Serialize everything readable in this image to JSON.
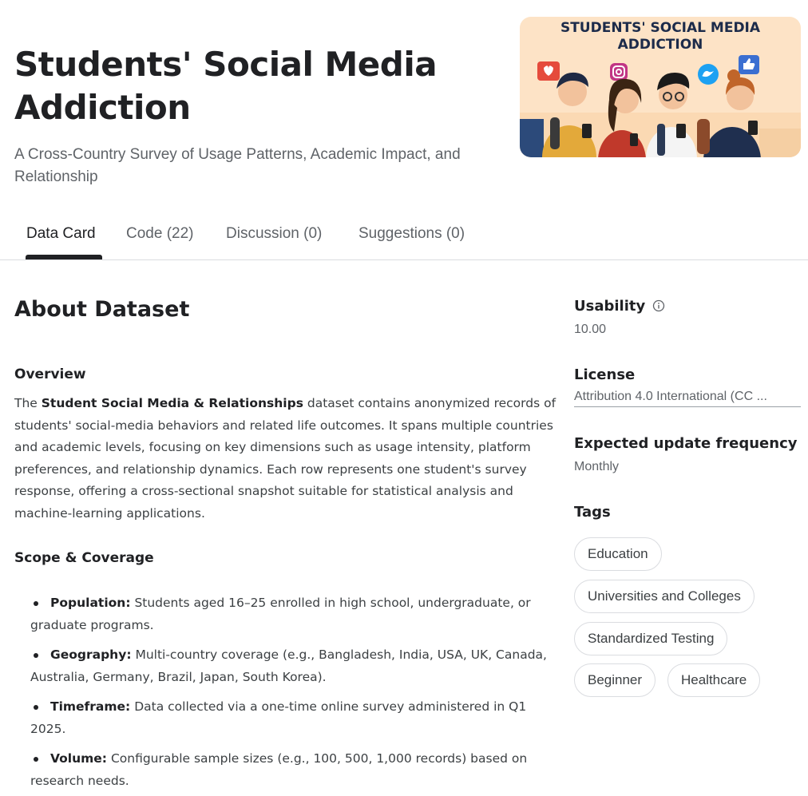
{
  "header": {
    "title": "Students' Social Media Addiction",
    "subtitle": "A Cross-Country Survey of Usage Patterns, Academic Impact, and Relationship",
    "banner_title_line1": "STUDENTS' SOCIAL MEDIA",
    "banner_title_line2": "ADDICTION"
  },
  "tabs": [
    {
      "label": "Data Card",
      "active": true
    },
    {
      "label": "Code (22)",
      "active": false
    },
    {
      "label": "Discussion (0)",
      "active": false
    },
    {
      "label": "Suggestions (0)",
      "active": false
    }
  ],
  "about": {
    "heading": "About Dataset",
    "overview_heading": "Overview",
    "overview_prefix": "The ",
    "overview_bold": "Student Social Media & Relationships",
    "overview_rest": " dataset contains anonymized records of students' social-media behaviors and related life outcomes. It spans multiple countries and academic levels, focusing on key dimensions such as usage intensity, platform preferences, and relationship dynamics. Each row represents one student's survey response, offering a cross-sectional snapshot suitable for statistical analysis and machine-learning applications.",
    "scope_heading": "Scope & Coverage",
    "bullets": [
      {
        "label": "Population:",
        "text": " Students aged 16–25 enrolled in high school, undergraduate, or graduate programs."
      },
      {
        "label": "Geography:",
        "text": " Multi-country coverage (e.g., Bangladesh, India, USA, UK, Canada, Australia, Germany, Brazil, Japan, South Korea)."
      },
      {
        "label": "Timeframe:",
        "text": " Data collected via a one-time online survey administered in Q1 2025."
      },
      {
        "label": "Volume:",
        "text": " Configurable sample sizes (e.g., 100, 500, 1,000 records) based on research needs."
      }
    ]
  },
  "sidebar": {
    "usability_label": "Usability",
    "usability_value": "10.00",
    "license_label": "License",
    "license_value": "Attribution 4.0 International (CC ...",
    "frequency_label": "Expected update frequency",
    "frequency_value": "Monthly",
    "tags_label": "Tags",
    "tags": [
      "Education",
      "Universities and Colleges",
      "Standardized Testing",
      "Beginner",
      "Healthcare"
    ]
  },
  "icons": {
    "info": "info-icon"
  },
  "colors": {
    "banner_bg": "#fde3c6",
    "text_primary": "#202124",
    "text_secondary": "#5f6368",
    "border": "#dadce0"
  }
}
